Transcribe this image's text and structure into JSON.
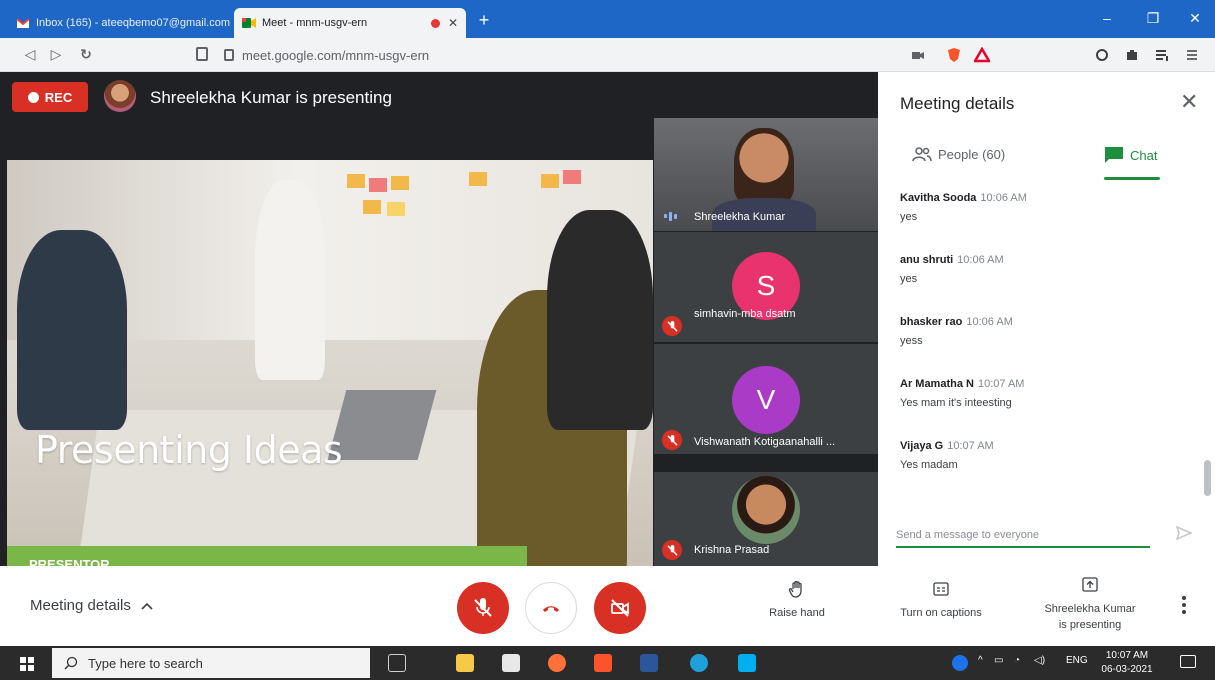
{
  "browser": {
    "tabs": [
      {
        "title": "Inbox (165) - ateeqbemo07@gmail.com",
        "active": false
      },
      {
        "title": "Meet - mnm-usgv-ern",
        "active": true
      }
    ],
    "url": "meet.google.com/mnm-usgv-ern",
    "window_controls": [
      "–",
      "❐",
      "✕"
    ]
  },
  "meeting": {
    "rec_label": "REC",
    "presenting_banner": "Shreelekha Kumar is presenting"
  },
  "slide": {
    "title": "Presenting Ideas",
    "bar_label": "PRESENTOR"
  },
  "participants": [
    {
      "name": "Shreelekha Kumar",
      "type": "video",
      "muted": false,
      "speaking": true
    },
    {
      "name": "simhavin-mba dsatm",
      "type": "letter",
      "initial": "S",
      "color": "#e8336f",
      "muted": true
    },
    {
      "name": "Vishwanath Kotigaanahalli ...",
      "type": "letter",
      "initial": "V",
      "color": "#a93bc7",
      "muted": true
    },
    {
      "name": "Krishna Prasad",
      "type": "photo",
      "muted": true
    }
  ],
  "panel": {
    "title": "Meeting details",
    "tabs": {
      "people": "People (60)",
      "chat": "Chat"
    },
    "messages": [
      {
        "sender": "Kavitha Sooda",
        "time": "10:06 AM",
        "text": "yes"
      },
      {
        "sender": "anu shruti",
        "time": "10:06 AM",
        "text": "yes"
      },
      {
        "sender": "bhasker rao",
        "time": "10:06 AM",
        "text": "yess"
      },
      {
        "sender": "Ar Mamatha N",
        "time": "10:07 AM",
        "text": "Yes mam it's inteesting"
      },
      {
        "sender": "Vijaya G",
        "time": "10:07 AM",
        "text": "Yes madam"
      }
    ],
    "compose_placeholder": "Send a message to everyone"
  },
  "controls": {
    "meeting_details": "Meeting details",
    "raise_hand": "Raise hand",
    "captions": "Turn on captions",
    "presenting_line1": "Shreelekha Kumar",
    "presenting_line2": "is presenting"
  },
  "taskbar": {
    "search_placeholder": "Type here to search",
    "lang": "ENG",
    "time": "10:07 AM",
    "date": "06-03-2021"
  },
  "colors": {
    "rec": "#d93025",
    "meet_green": "#1e8e3e",
    "presentor_bar": "#7ab648",
    "tab_bar": "#1f67c7"
  }
}
